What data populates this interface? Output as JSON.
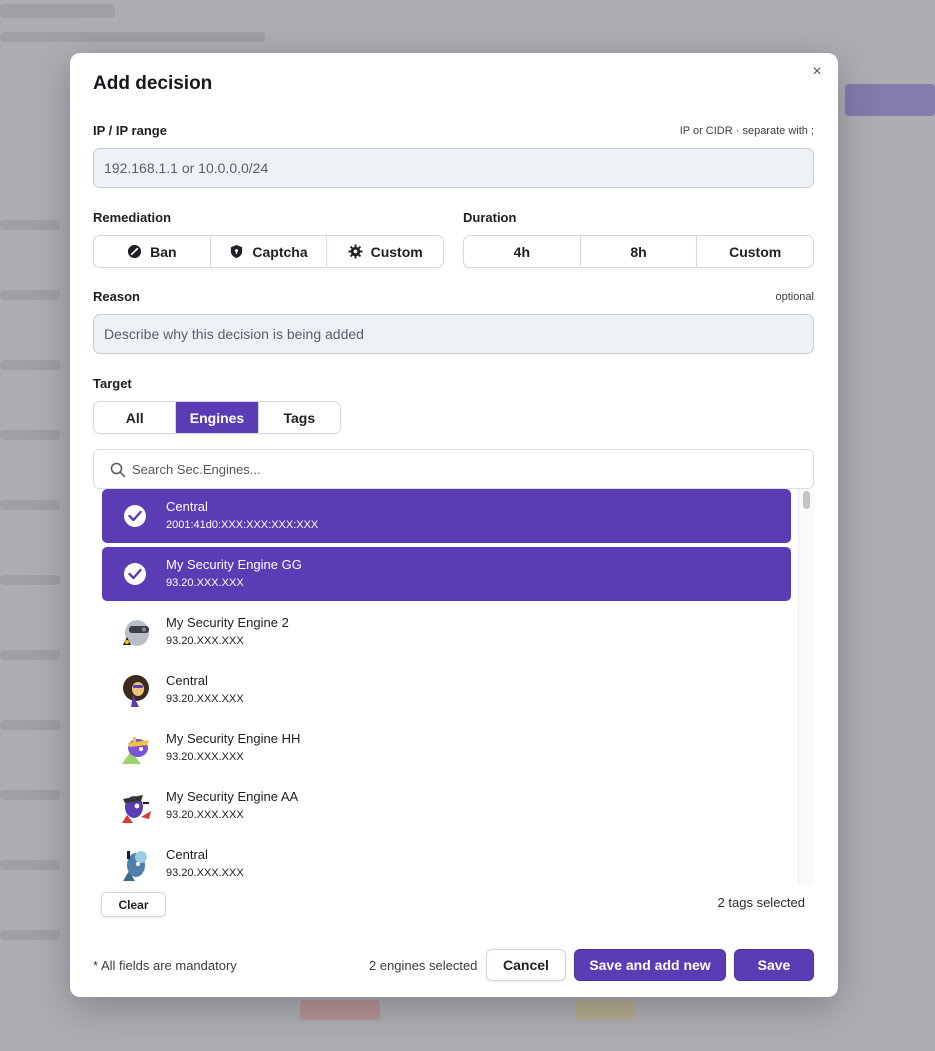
{
  "modal": {
    "title": "Add decision",
    "close_glyph": "×"
  },
  "ip": {
    "label": "IP / IP range",
    "hint": "IP or CIDR · separate with ;",
    "placeholder": "192.168.1.1 or 10.0.0.0/24"
  },
  "remediation": {
    "label": "Remediation",
    "options": [
      {
        "label": "Ban",
        "icon": "ban-icon"
      },
      {
        "label": "Captcha",
        "icon": "shield-icon"
      },
      {
        "label": "Custom",
        "icon": "gear-icon"
      }
    ]
  },
  "duration": {
    "label": "Duration",
    "options": [
      "4h",
      "8h",
      "Custom"
    ]
  },
  "reason": {
    "label": "Reason",
    "hint": "optional",
    "placeholder": "Describe why this decision is being added"
  },
  "target": {
    "label": "Target",
    "tabs": [
      "All",
      "Engines",
      "Tags"
    ],
    "active_tab": "Engines"
  },
  "search": {
    "placeholder": "Search Sec.Engines..."
  },
  "engines": [
    {
      "name": "Central",
      "ip": "2001:41d0:XXX:XXX:XXX:XXX",
      "selected": true
    },
    {
      "name": "My Security Engine GG",
      "ip": "93.20.XXX.XXX",
      "selected": true
    },
    {
      "name": "My Security Engine 2",
      "ip": "93.20.XXX.XXX",
      "selected": false,
      "avatar": "mascot-goggles-avatar"
    },
    {
      "name": "Central",
      "ip": "93.20.XXX.XXX",
      "selected": false,
      "avatar": "mascot-circle-avatar"
    },
    {
      "name": "My Security Engine HH",
      "ip": "93.20.XXX.XXX",
      "selected": false,
      "avatar": "mascot-purple-avatar"
    },
    {
      "name": "My Security Engine AA",
      "ip": "93.20.XXX.XXX",
      "selected": false,
      "avatar": "mascot-hat-avatar"
    },
    {
      "name": "Central",
      "ip": "93.20.XXX.XXX",
      "selected": false,
      "avatar": "mascot-blue-avatar"
    }
  ],
  "list_footer": {
    "clear_label": "Clear",
    "tags_selected": "2 tags selected"
  },
  "footer": {
    "note": "* All fields are mandatory",
    "engines_selected": "2 engines selected",
    "cancel_label": "Cancel",
    "save_new_label": "Save and add new",
    "save_label": "Save"
  },
  "colors": {
    "accent": "#5b3cb4",
    "input_bg": "#eef1f6"
  }
}
